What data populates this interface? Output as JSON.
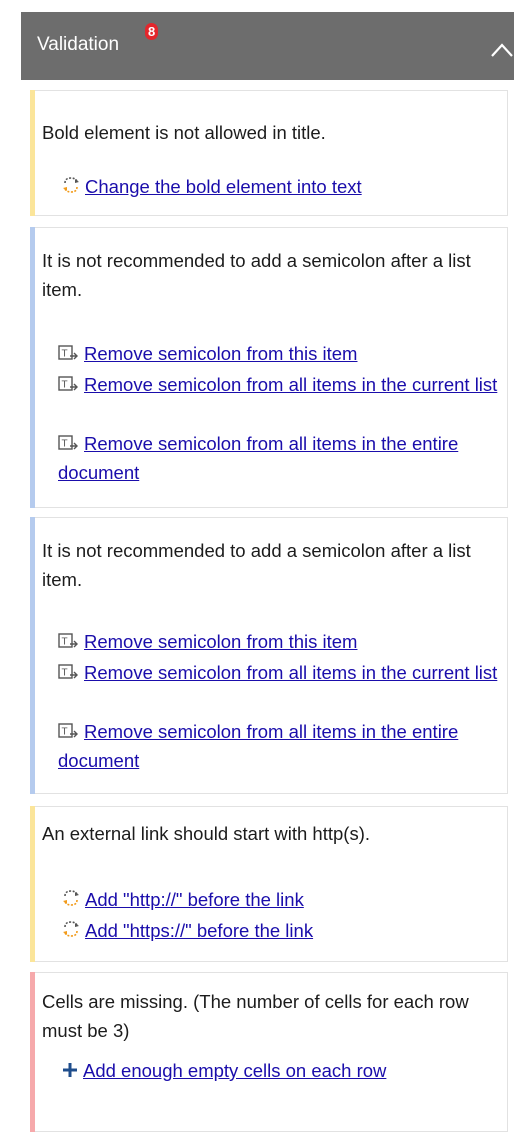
{
  "header": {
    "title": "Validation",
    "badge": "8"
  },
  "colors": {
    "warning": "#fbe59a",
    "info": "#b5cbee",
    "error": "#f6a9ab",
    "link": "#1a0dab",
    "header": "#6d6d6d"
  },
  "cards": [
    {
      "severity": "warning",
      "message": "Bold element is not allowed in title.",
      "actions": [
        {
          "icon": "convert-icon",
          "label": "Change the bold element into text"
        }
      ]
    },
    {
      "severity": "info",
      "message": "It is not recommended to add a semicolon after a list item.",
      "actions": [
        {
          "icon": "text-fix-icon",
          "label": "Remove semicolon from this item"
        },
        {
          "icon": "text-fix-icon",
          "label": "Remove semicolon from all items in the current list"
        },
        {
          "icon": "text-fix-icon",
          "label": "Remove semicolon from all items in the entire document"
        }
      ]
    },
    {
      "severity": "info",
      "message": "It is not recommended to add a semicolon after a list item.",
      "actions": [
        {
          "icon": "text-fix-icon",
          "label": "Remove semicolon from this item"
        },
        {
          "icon": "text-fix-icon",
          "label": "Remove semicolon from all items in the current list"
        },
        {
          "icon": "text-fix-icon",
          "label": "Remove semicolon from all items in the entire document"
        }
      ]
    },
    {
      "severity": "warning",
      "message": "An external link should start with http(s).",
      "actions": [
        {
          "icon": "convert-icon",
          "label": "Add \"http://\" before the link"
        },
        {
          "icon": "convert-icon",
          "label": "Add \"https://\" before the link"
        }
      ]
    },
    {
      "severity": "error",
      "message": "Cells are missing. (The number of cells for each row must be 3)",
      "actions": [
        {
          "icon": "plus-icon",
          "label": "Add enough empty cells on each row"
        }
      ]
    }
  ]
}
